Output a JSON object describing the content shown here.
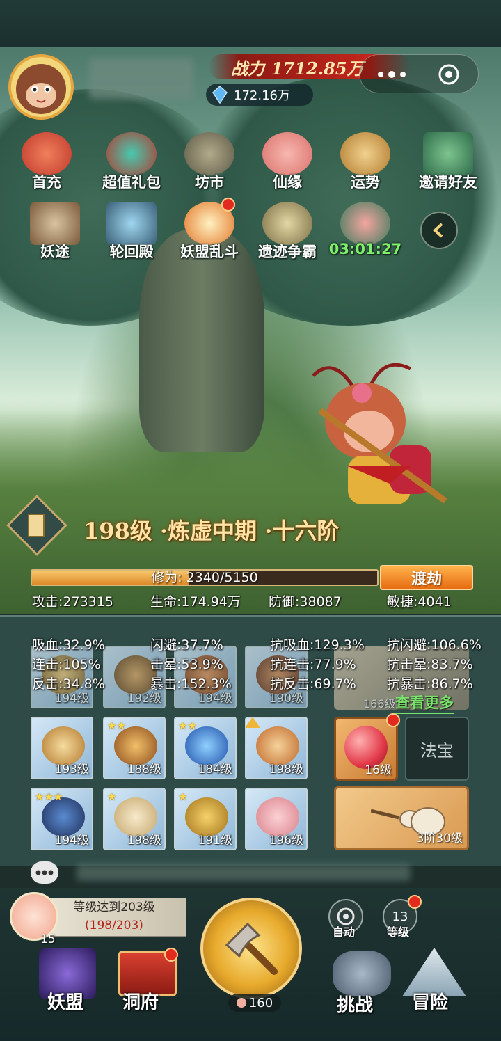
{
  "header": {
    "power_label": "战力",
    "power_value": "1712.85万",
    "gems": "172.16万",
    "more_icon": "more-dots-icon",
    "close_icon": "target-icon"
  },
  "activities": {
    "row1": [
      {
        "label": "首充",
        "icon": "money-bag-icon"
      },
      {
        "label": "超值礼包",
        "icon": "gift-bag-icon"
      },
      {
        "label": "坊市",
        "icon": "coin-market-icon"
      },
      {
        "label": "仙缘",
        "icon": "lotus-icon"
      },
      {
        "label": "运势",
        "icon": "fortune-sticks-icon"
      },
      {
        "label": "邀请好友",
        "icon": "invite-book-icon"
      }
    ],
    "row2": [
      {
        "label": "妖途",
        "icon": "book-icon"
      },
      {
        "label": "轮回殿",
        "icon": "gate-icon"
      },
      {
        "label": "妖盟乱斗",
        "icon": "battle-icon"
      },
      {
        "label": "遗迹争霸",
        "icon": "relic-icon"
      },
      {
        "label": "03:01:27",
        "icon": "treasure-bag-icon"
      }
    ],
    "collapse_icon": "chevron-left-icon"
  },
  "character": {
    "level_text": "198级 ·炼虚中期 ·十六阶",
    "cultivation": "修为: 2340/5150",
    "cultivation_progress": 0.454,
    "breakthrough_label": "渡劫"
  },
  "stats": {
    "attack": "攻击:273315",
    "hp": "生命:174.94万",
    "defense": "防御:38087",
    "agility": "敏捷:4041"
  },
  "secondary_stats": [
    "吸血:32.9%",
    "闪避:37.7%",
    "抗吸血:129.3%",
    "抗闪避:106.6%",
    "连击:105%",
    "击晕:53.9%",
    "抗连击:77.9%",
    "抗击晕:83.7%",
    "反击:34.8%",
    "暴击:152.3%",
    "抗反击:69.7%",
    "抗暴击:86.7%"
  ],
  "view_more": "查看更多",
  "equipment": {
    "row1": [
      "194级",
      "192级",
      "194级",
      "190级"
    ],
    "row1_extra": "166级",
    "row2": [
      {
        "level": "193级",
        "stars": ""
      },
      {
        "level": "188级",
        "stars": "★★"
      },
      {
        "level": "184级",
        "stars": "★★"
      },
      {
        "level": "198级",
        "stars": ""
      }
    ],
    "row3": [
      {
        "level": "194级",
        "stars": "★★★"
      },
      {
        "level": "198级",
        "stars": "★"
      },
      {
        "level": "191级",
        "stars": "★"
      },
      {
        "level": "196级",
        "stars": ""
      }
    ]
  },
  "treasure": {
    "orb_level": "16级",
    "fabao_label": "法宝",
    "gourd_level": "3阶30级"
  },
  "task": {
    "title": "等级达到203级",
    "progress": "(198/203)",
    "count": "15"
  },
  "main_action": {
    "count": "160"
  },
  "quick": {
    "auto_label": "自动",
    "level_label": "等级",
    "level_value": "13"
  },
  "nav": [
    "妖盟",
    "洞府",
    "挑战",
    "冒险"
  ],
  "colors": {
    "accent": "#e66c12",
    "badge": "#e32a1e",
    "panel": "#2e4b47"
  }
}
